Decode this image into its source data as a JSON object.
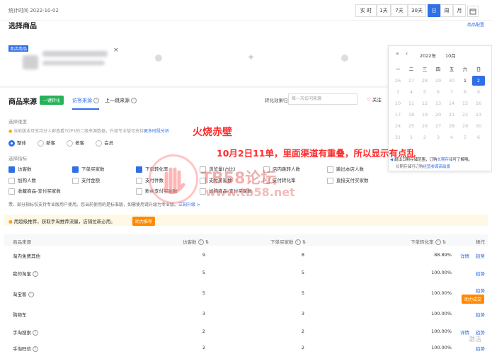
{
  "header": {
    "stat_time": "统计时间 2022-10-02",
    "ranges": [
      "实 时",
      "1天",
      "7天",
      "30天",
      "日",
      "周",
      "月"
    ],
    "active_range": "日"
  },
  "select_product": {
    "title": "选择商品",
    "right_link": "商品配置",
    "item_label": "本店商品",
    "close": "×",
    "plus": "+"
  },
  "source": {
    "title": "商品来源",
    "tag": "一键转化",
    "tabs": [
      "访客来源",
      "上一跳来源"
    ],
    "active_tab": "访客来源",
    "attr_label": "转化效果归属于:",
    "attr_select": "每一次访问来源",
    "follow": "关注",
    "dimension_label": "选择维度",
    "notice": "当前版本可支持分人群查看TOP3的二级来源数据，升级专业版可支持",
    "notice_link": "更多时段分析",
    "dimension_options": [
      "整体",
      "新客",
      "老客",
      "会员"
    ],
    "metric_label": "选择指标",
    "metrics": [
      [
        "访客数",
        "下单买家数",
        "下单转化率",
        "浏览量(占比)",
        "店内跳转人数",
        "跳出本店人数"
      ],
      [
        "加购人数",
        "支付金额",
        "支付件数",
        "支付买家数",
        "支付转化率",
        "直接支付买家数"
      ],
      [
        "收藏商品-支付买家数",
        "",
        "粉丝支付买家数",
        "加购商品-支付买家数",
        "",
        ""
      ]
    ],
    "metrics_checked": [
      "访客数",
      "下单买家数",
      "下单转化率"
    ],
    "pro_notice": "票、部分指标仅支持专业版用户使用。您当前使用的是标准版，如需使用请升级为专业版。",
    "pro_link": "立刻升级 >"
  },
  "promo": {
    "text": "用超级推荐，获取手淘推荐流量，店铺拉新必用。",
    "button": "助力推荐"
  },
  "table": {
    "headers": [
      "商品来源",
      "访客数",
      "下单买家数",
      "下单转化率",
      "操作"
    ],
    "rows": [
      {
        "source": "淘内免费其他",
        "visitors": "9",
        "buyers": "8",
        "rate": "88.89%",
        "actions": [
          "详情",
          "趋势"
        ]
      },
      {
        "source": "我的淘宝",
        "visitors": "5",
        "buyers": "5",
        "rate": "100.00%",
        "actions": [
          "趋势"
        ]
      },
      {
        "source": "淘宝客",
        "visitors": "5",
        "buyers": "5",
        "rate": "100.00%",
        "actions": [
          "趋势",
          "助力成交"
        ]
      },
      {
        "source": "购物车",
        "visitors": "3",
        "buyers": "3",
        "rate": "100.00%",
        "actions": [
          "趋势"
        ]
      },
      {
        "source": "手淘搜索",
        "visitors": "2",
        "buyers": "2",
        "rate": "100.00%",
        "actions": [
          "详情",
          "趋势"
        ]
      },
      {
        "source": "手淘旺信",
        "visitors": "2",
        "buyers": "2",
        "rate": "100.00%",
        "actions": [
          "趋势"
        ]
      }
    ]
  },
  "calendar": {
    "year": "2022年",
    "month": "10月",
    "nav_prev_year": "«",
    "nav_prev": "‹",
    "nav_next": "›",
    "nav_next_year": "»",
    "weekdays": [
      "一",
      "二",
      "三",
      "四",
      "五",
      "六",
      "日"
    ],
    "days": [
      [
        "26",
        "27",
        "28",
        "29",
        "30",
        "1",
        "2"
      ],
      [
        "3",
        "4",
        "5",
        "6",
        "7",
        "8",
        "9"
      ],
      [
        "10",
        "11",
        "12",
        "13",
        "14",
        "15",
        "16"
      ],
      [
        "17",
        "18",
        "19",
        "20",
        "21",
        "22",
        "23"
      ],
      [
        "24",
        "25",
        "26",
        "27",
        "28",
        "29",
        "30"
      ],
      [
        "31",
        "1",
        "2",
        "3",
        "4",
        "5",
        "6"
      ]
    ],
    "selected": "2",
    "footer1": "超出日期存储范围，订购",
    "footer1_link": "长期存储",
    "footer1_tail": "可了解哦。",
    "footer2": "长期存储可订购",
    "footer2_link": "经营参谋高级版"
  },
  "overlay": {
    "name": "火烧赤壁",
    "note": "10月2日11单，里面渠道有重叠，所以显示有点乱",
    "wm_title": "TB58论坛",
    "wm_url": "www.tb58.net",
    "corner": "激活"
  }
}
